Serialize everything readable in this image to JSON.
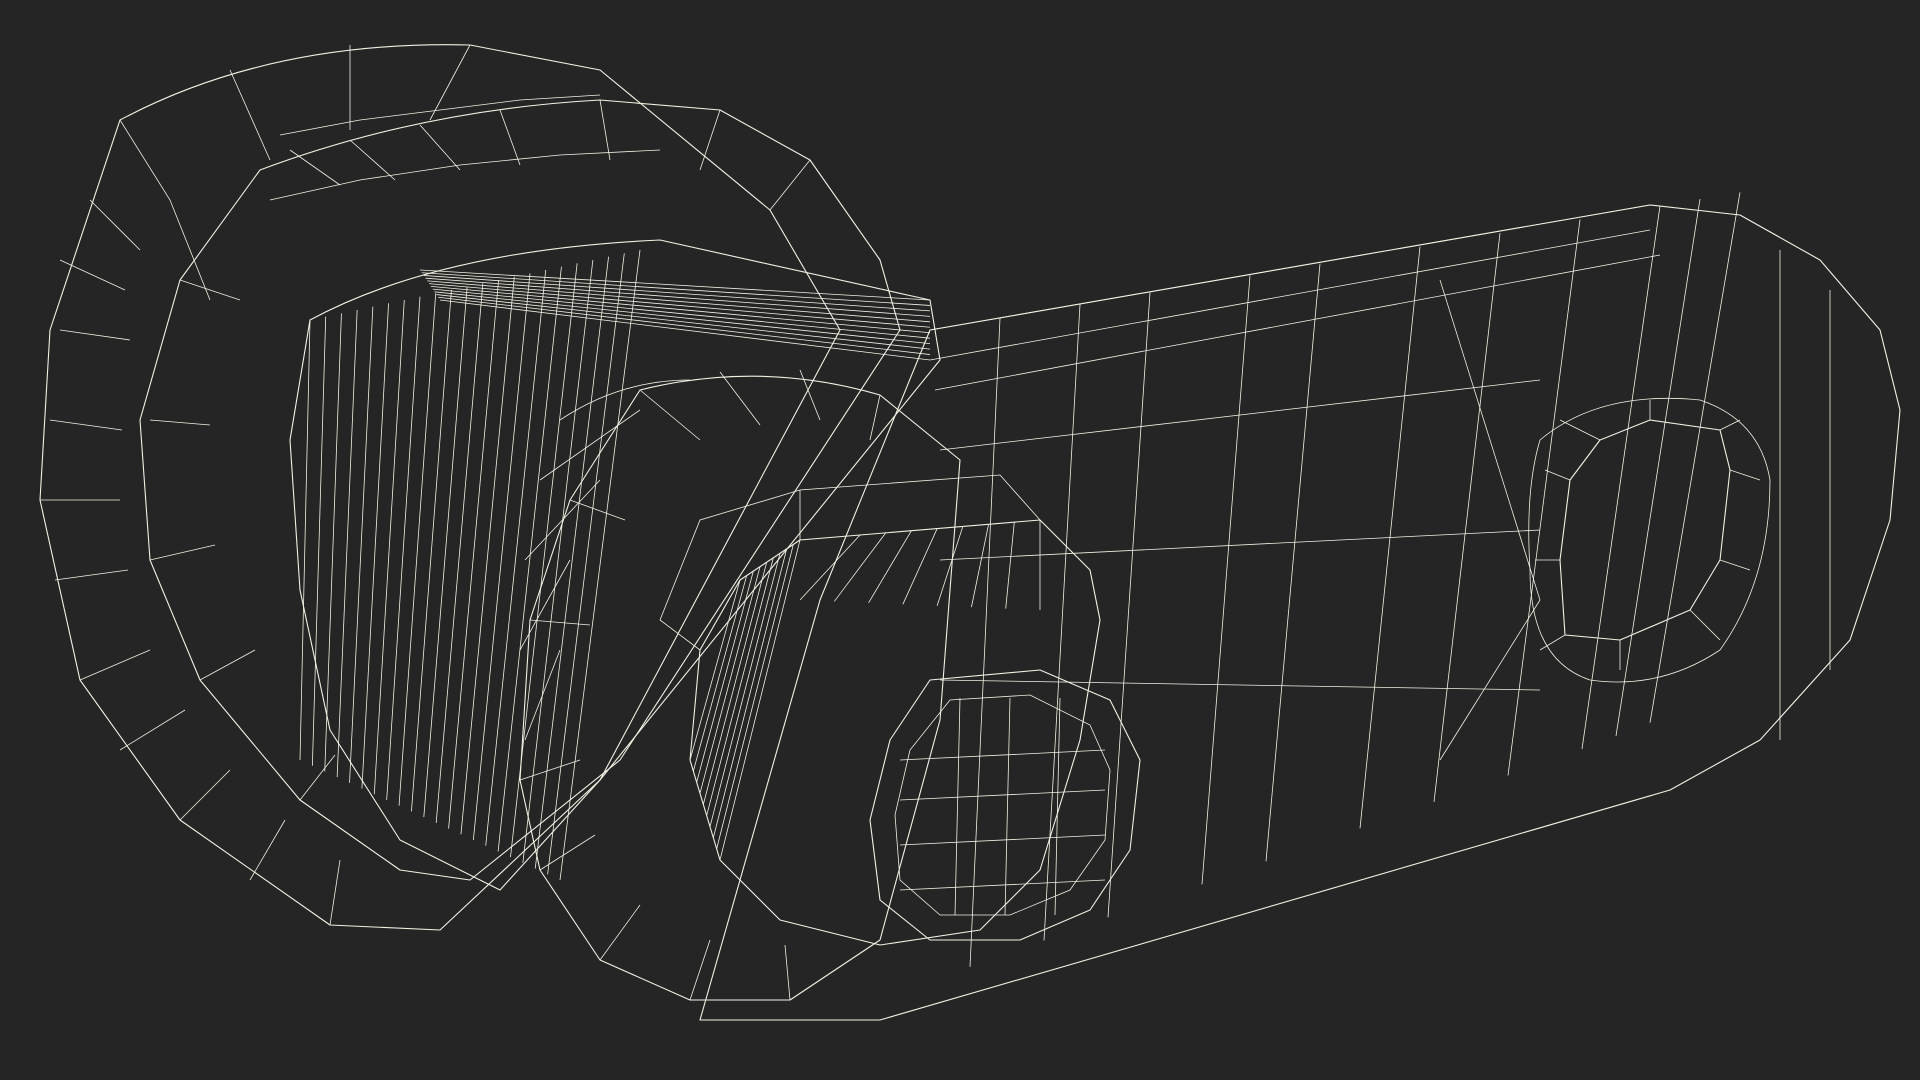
{
  "scene": {
    "subject": "cam-lock-wireframe",
    "colors": {
      "background": "#252525",
      "surface": "#7b7c6d",
      "surface_light": "#8a8b7c",
      "surface_dark": "#5f6055",
      "wire": "#f3f1e4",
      "hole": "#1e1e1e"
    }
  }
}
